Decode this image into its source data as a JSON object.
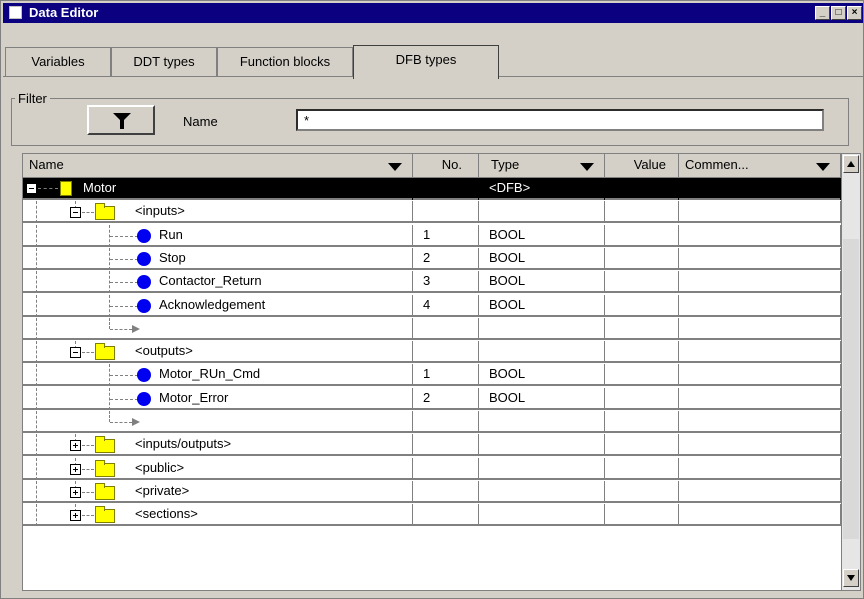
{
  "window": {
    "title": "Data Editor"
  },
  "tabs": [
    {
      "label": "Variables"
    },
    {
      "label": "DDT types"
    },
    {
      "label": "Function blocks"
    },
    {
      "label": "DFB types",
      "active": true
    }
  ],
  "filter": {
    "legend": "Filter",
    "name_label": "Name",
    "name_value": "*"
  },
  "columns": {
    "name": "Name",
    "no": "No.",
    "type": "Type",
    "value": "Value",
    "comment": "Commen..."
  },
  "rows": [
    {
      "kind": "dfb",
      "label": "Motor",
      "type": "<DFB>",
      "no": "",
      "selected": true
    },
    {
      "kind": "folder",
      "label": "<inputs>",
      "no": "",
      "type": "",
      "expanded": true
    },
    {
      "kind": "var",
      "label": "Run",
      "no": "1",
      "type": "BOOL"
    },
    {
      "kind": "var",
      "label": "Stop",
      "no": "2",
      "type": "BOOL"
    },
    {
      "kind": "var",
      "label": "Contactor_Return",
      "no": "3",
      "type": "BOOL"
    },
    {
      "kind": "var",
      "label": "Acknowledgement",
      "no": "4",
      "type": "BOOL"
    },
    {
      "kind": "new",
      "label": "",
      "no": "",
      "type": ""
    },
    {
      "kind": "folder",
      "label": "<outputs>",
      "no": "",
      "type": "",
      "expanded": true
    },
    {
      "kind": "var",
      "label": "Motor_RUn_Cmd",
      "no": "1",
      "type": "BOOL"
    },
    {
      "kind": "var",
      "label": "Motor_Error",
      "no": "2",
      "type": "BOOL"
    },
    {
      "kind": "new",
      "label": "",
      "no": "",
      "type": ""
    },
    {
      "kind": "folder",
      "label": "<inputs/outputs>",
      "no": "",
      "type": "",
      "expanded": false
    },
    {
      "kind": "folder",
      "label": "<public>",
      "no": "",
      "type": "",
      "expanded": false
    },
    {
      "kind": "folder",
      "label": "<private>",
      "no": "",
      "type": "",
      "expanded": false
    },
    {
      "kind": "folder",
      "label": "<sections>",
      "no": "",
      "type": "",
      "expanded": false
    }
  ],
  "colors": {
    "titlebar": "#0a0080",
    "selection": "#000000",
    "folder": "#ffff00",
    "variable": "#0000f0"
  }
}
